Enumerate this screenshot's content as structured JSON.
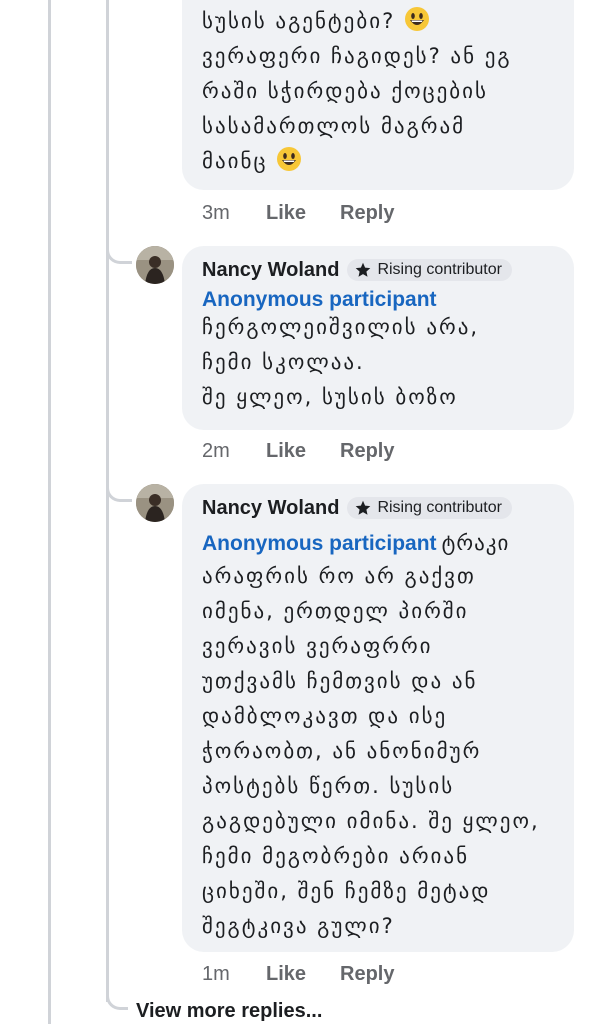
{
  "comments": [
    {
      "lines_before_emoji": "სუსის აგენტები?",
      "lines_after": "ვერაფერი ჩაგიდეს? ან ეგ\nრაში სჭირდება ქოცების\nსასამართლოს მაგრამ\nმაინც",
      "emoji": "grinning-face",
      "time": "3m",
      "like": "Like",
      "reply": "Reply"
    },
    {
      "author": "Nancy Woland",
      "badge": "Rising contributor",
      "mention": "Anonymous participant",
      "text": "ჩერგოლეიშვილის არა,\nჩემი სკოლაა.\nშე ყლეო, სუსის ბოზო",
      "time": "2m",
      "like": "Like",
      "reply": "Reply"
    },
    {
      "author": "Nancy Woland",
      "badge": "Rising contributor",
      "mention": "Anonymous participant",
      "text_first_line": "ტრაკი",
      "text": "არაფრის რო არ გაქვთ\nიმენა, ერთდელ პირში\nვერავის ვერაფრრი\nუთქვამს ჩემთვის და ან\nდამბლოკავთ და ისე\nჭორაობთ, ან ანონიმურ\nპოსტებს წერთ. სუსის\nგაგდებული იმინა. შე ყლეო,\nჩემი მეგობრები არიან\nციხეში, შენ ჩემზე მეტად\nშეგტკივა გული?",
      "time": "1m",
      "like": "Like",
      "reply": "Reply"
    }
  ],
  "view_more": "View more replies..."
}
